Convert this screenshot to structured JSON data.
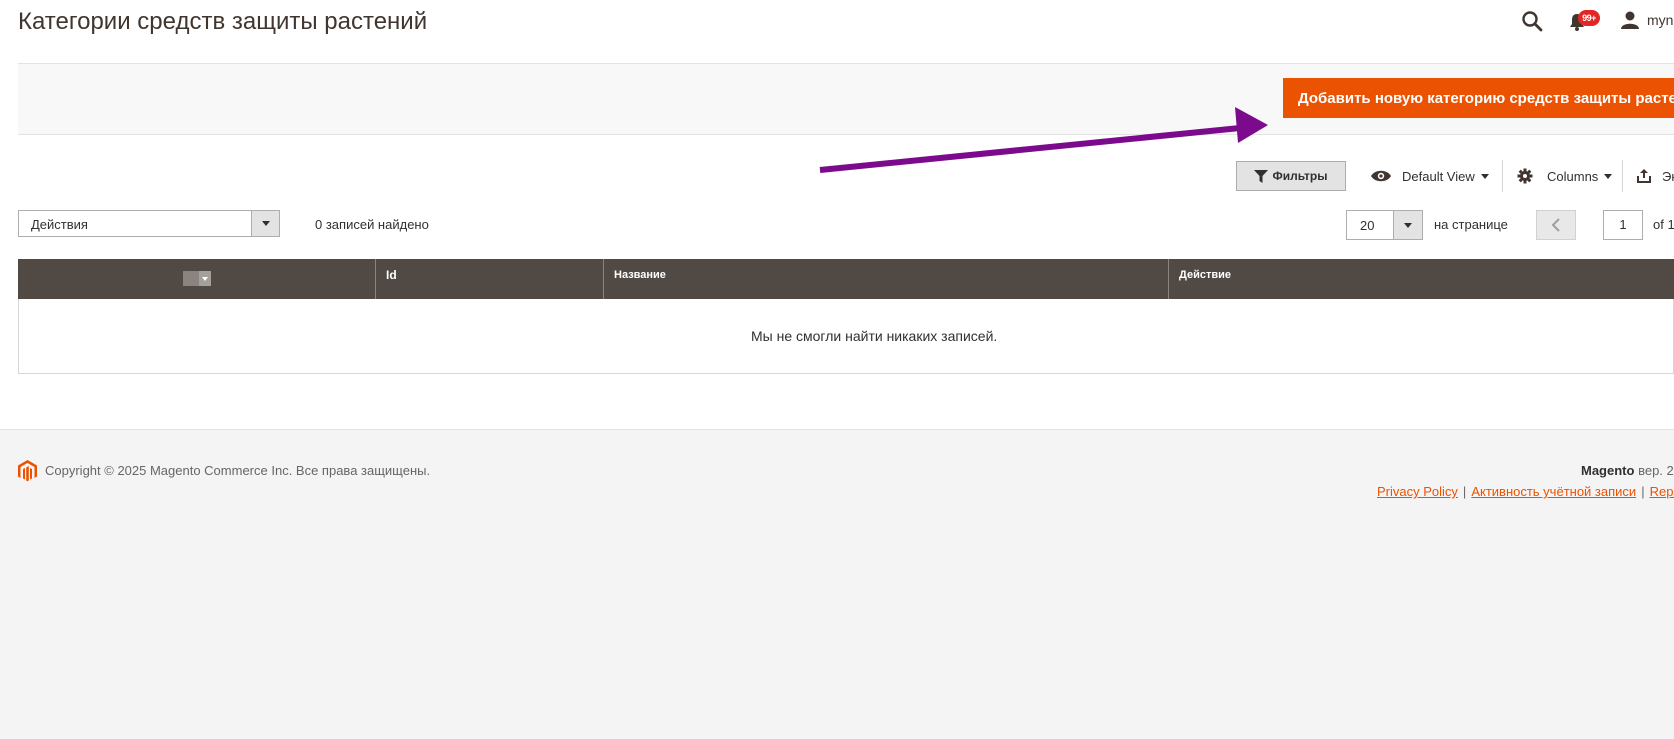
{
  "header": {
    "title": "Категории средств защиты растений",
    "notifications_count": "99+",
    "user_name": "myne"
  },
  "actions": {
    "add_button_label": "Добавить новую категорию средств защиты растений"
  },
  "toolbar": {
    "filters_label": "Фильтры",
    "view_label": "Default View",
    "columns_label": "Columns",
    "export_label": "Экспорт"
  },
  "grid_controls": {
    "mass_action_label": "Действия",
    "records_found": "0 записей найдено",
    "per_page_value": "20",
    "per_page_label": "на странице",
    "current_page": "1",
    "page_of": "of 1"
  },
  "grid": {
    "columns": [
      "Id",
      "Название",
      "Действие"
    ],
    "empty_message": "Мы не смогли найти никаких записей."
  },
  "footer": {
    "copyright": "Copyright © 2025 Magento Commerce Inc. Все права защищены.",
    "brand": "Magento",
    "version": "вер. 2",
    "links": [
      "Privacy Policy",
      "Активность учётной записи",
      "Report an Issue"
    ]
  },
  "colors": {
    "accent": "#eb5202",
    "grid_header": "#514943",
    "annotation_arrow": "#7b0a8c",
    "badge": "#e22626"
  }
}
